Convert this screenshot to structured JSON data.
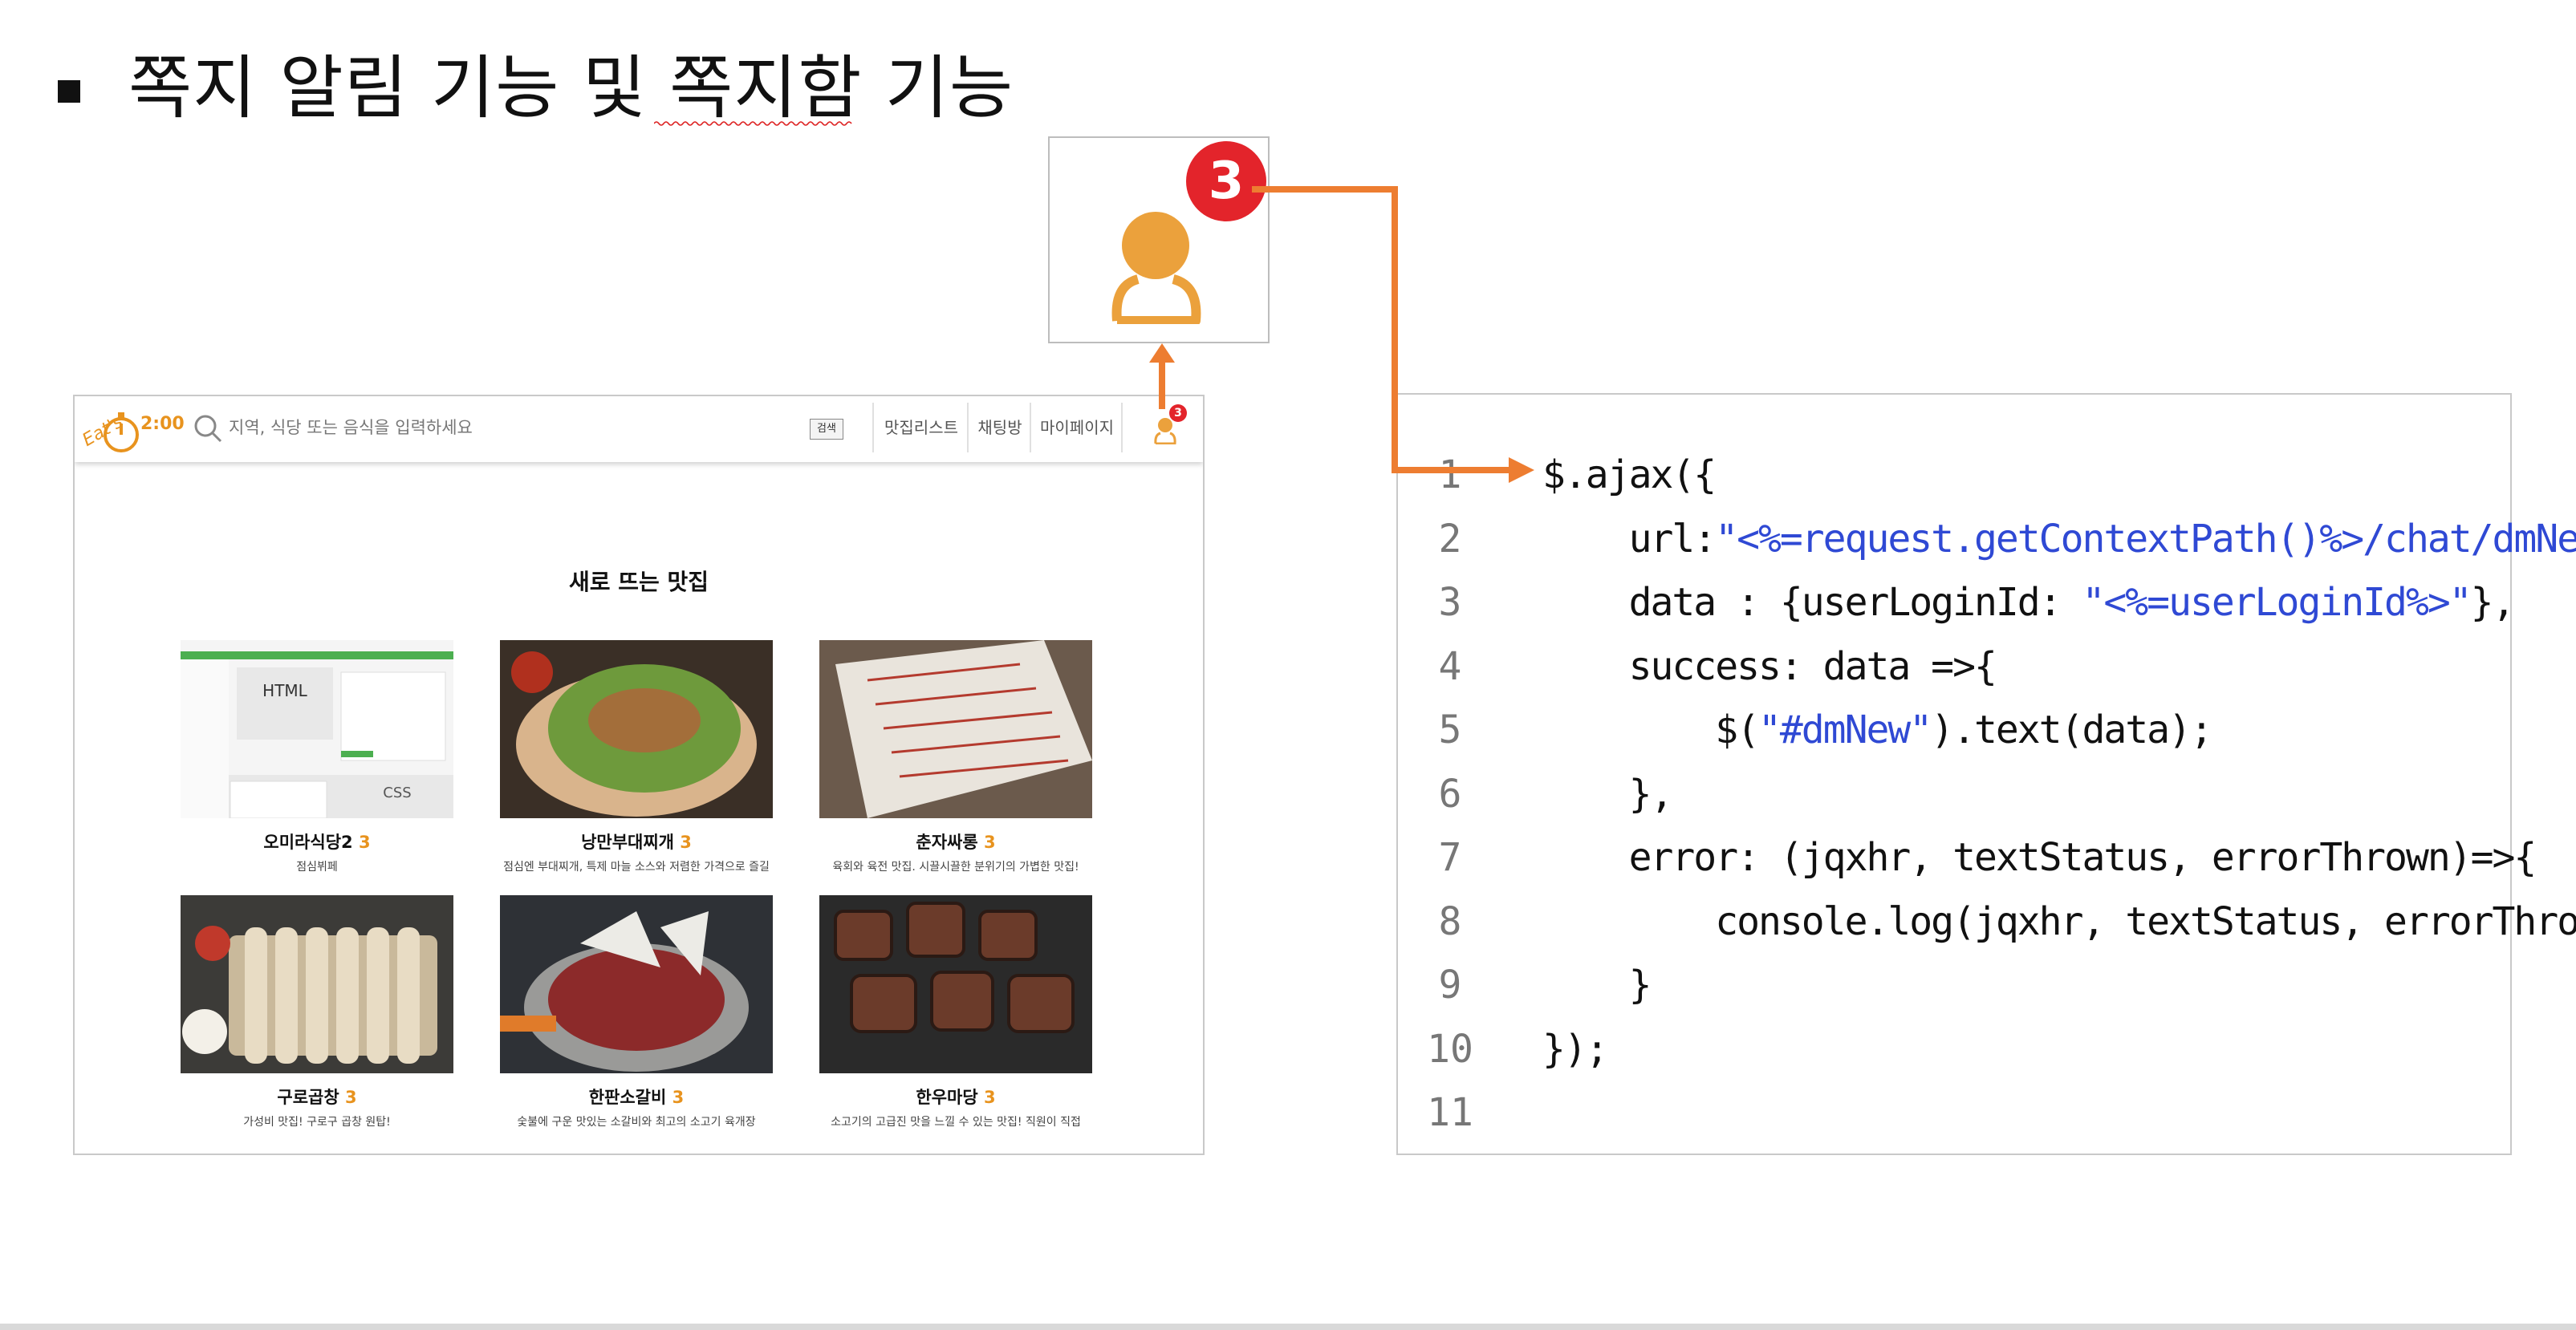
{
  "slide": {
    "title": "쪽지 알림 기능 및 쪽지함 기능"
  },
  "zoom_badge": {
    "count": "3"
  },
  "site": {
    "logo_text": "2:00",
    "search_placeholder": "지역, 식당 또는 음식을 입력하세요",
    "search_button": "검색",
    "nav": [
      "맛집리스트",
      "채팅방",
      "마이페이지"
    ],
    "notification_count": "3",
    "section_title": "새로 뜨는 맛집",
    "cards": [
      {
        "name": "오미라식당2",
        "rating": "3",
        "desc": "점심뷔페"
      },
      {
        "name": "낭만부대찌개",
        "rating": "3",
        "desc": "점심엔 부대찌개, 특제 마늘 소스와 저렴한 가격으로 즐길"
      },
      {
        "name": "춘자싸롱",
        "rating": "3",
        "desc": "육회와 육전 맛집. 시끌시끌한 분위기의 가볍한 맛집!"
      },
      {
        "name": "구로곱창",
        "rating": "3",
        "desc": "가성비 맛집! 구로구 곱창 원탑!"
      },
      {
        "name": "한판소갈비",
        "rating": "3",
        "desc": "숯불에 구운 맛있는 소갈비와 최고의 소고기 육개장"
      },
      {
        "name": "한우마당",
        "rating": "3",
        "desc": "소고기의 고급진 맛을 느낄 수 있는 맛집! 직원이 직접"
      }
    ]
  },
  "code": {
    "line_numbers": [
      "1",
      "2",
      "3",
      "4",
      "5",
      "6",
      "7",
      "8",
      "9",
      "10",
      "11"
    ],
    "lines": [
      {
        "pre": "$.ajax({",
        "str": "",
        "post": ""
      },
      {
        "pre": "    url:",
        "str": "\"<%=request.getContextPath()%>/chat/dmNew\"",
        "post": ","
      },
      {
        "pre": "    data : {userLoginId: ",
        "str": "\"<%=userLoginId%>\"",
        "post": "},"
      },
      {
        "pre": "    success: data =>{",
        "str": "",
        "post": ""
      },
      {
        "pre": "        $(",
        "str": "\"#dmNew\"",
        "post": ").text(data);"
      },
      {
        "pre": "    },",
        "str": "",
        "post": ""
      },
      {
        "pre": "    error: (jqxhr, textStatus, errorThrown)=>{",
        "str": "",
        "post": ""
      },
      {
        "pre": "        console.log(jqxhr, textStatus, errorThrown);",
        "str": "",
        "post": ""
      },
      {
        "pre": "    }",
        "str": "",
        "post": ""
      },
      {
        "pre": "});",
        "str": "",
        "post": ""
      },
      {
        "pre": "",
        "str": "",
        "post": ""
      }
    ]
  },
  "colors": {
    "accent_orange": "#ed7d31",
    "badge_red": "#e3242b",
    "rating_orange": "#e8931e",
    "code_string": "#2f49d4"
  }
}
